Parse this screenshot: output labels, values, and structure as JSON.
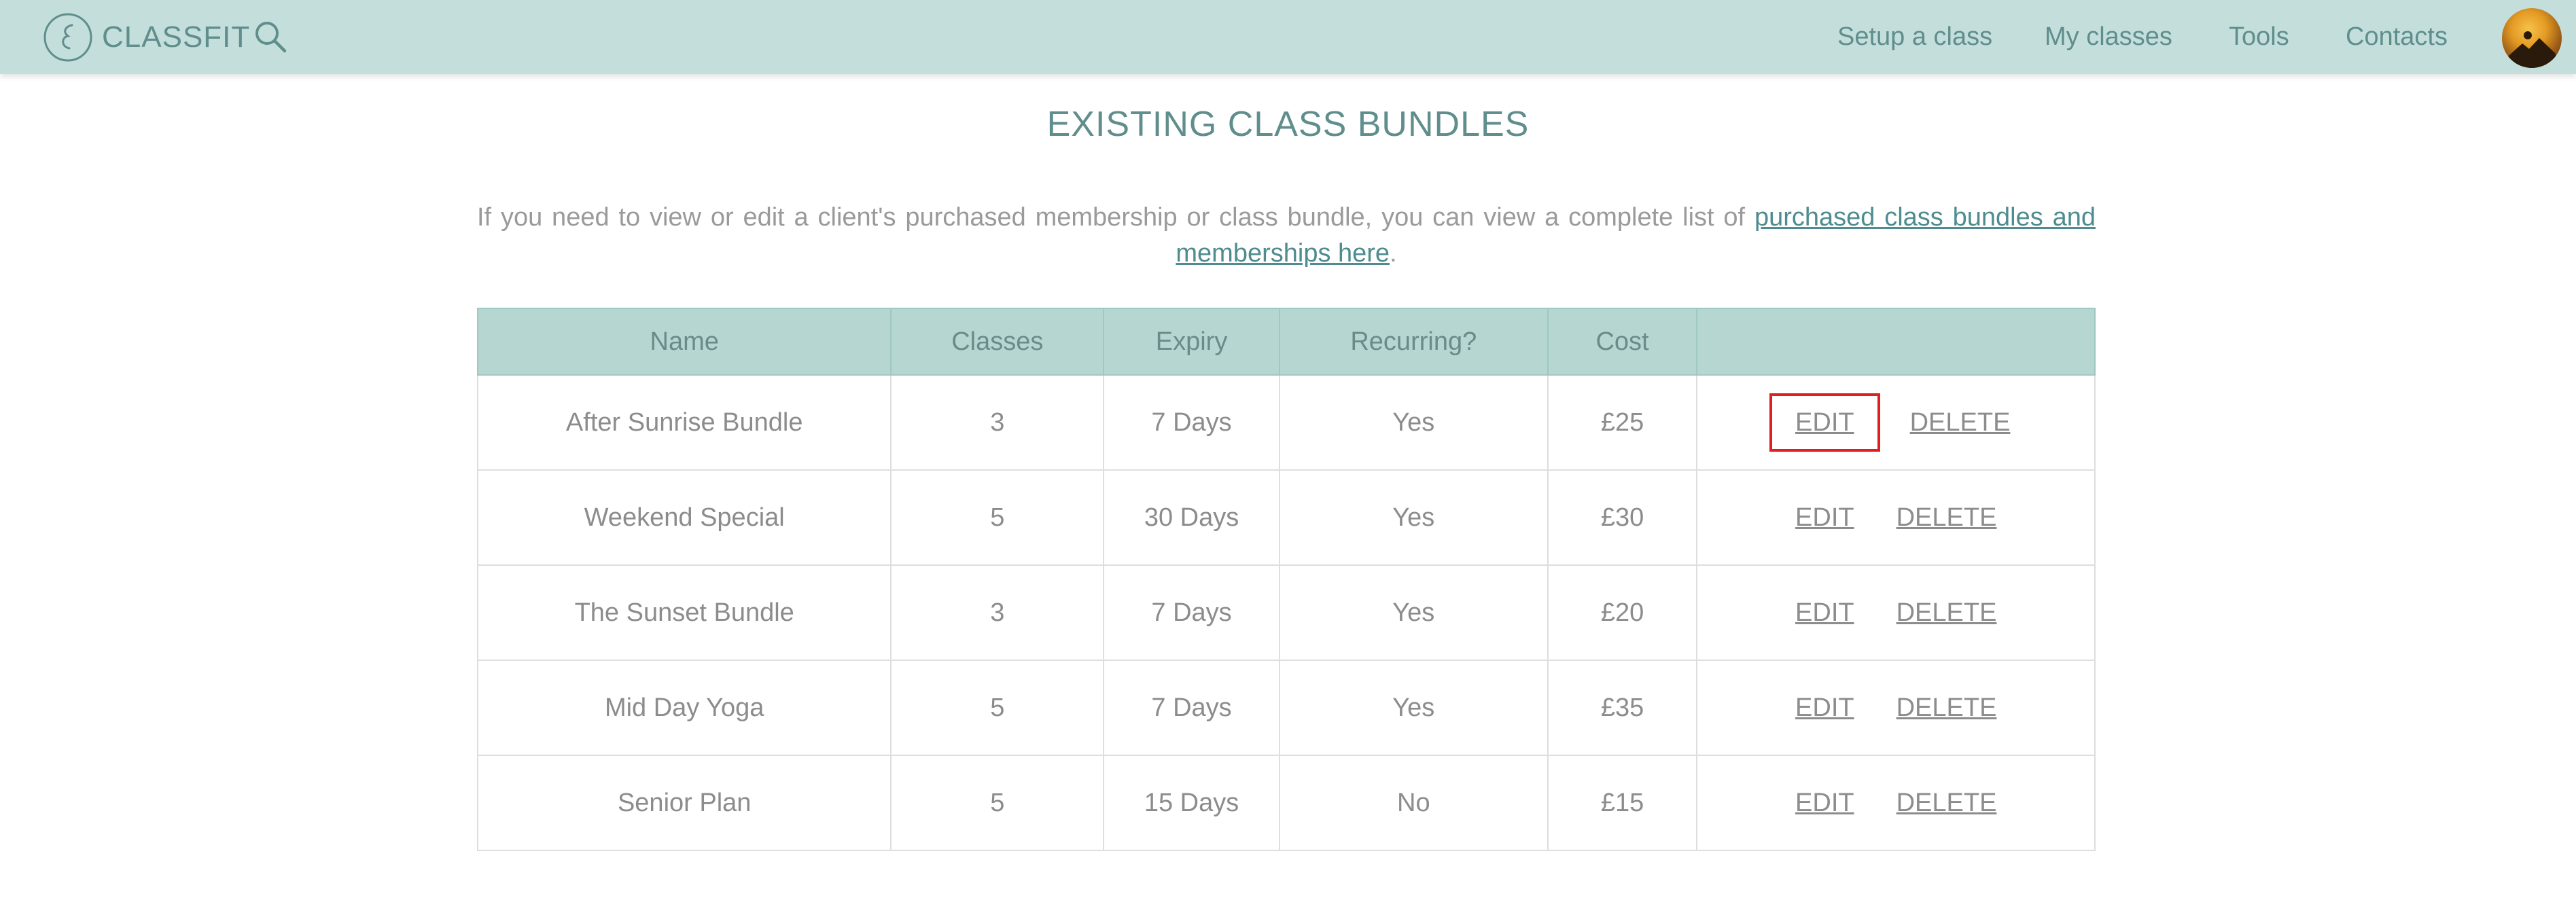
{
  "nav": {
    "brand": "CLASSFIT",
    "links": [
      "Setup a class",
      "My classes",
      "Tools",
      "Contacts"
    ]
  },
  "page": {
    "title": "EXISTING CLASS BUNDLES",
    "intro_text": "If you need to view or edit a client's purchased membership or class bundle, you can view a complete list of ",
    "intro_link": "purchased class bundles and memberships here",
    "intro_end": "."
  },
  "table": {
    "headers": [
      "Name",
      "Classes",
      "Expiry",
      "Recurring?",
      "Cost",
      ""
    ],
    "rows": [
      {
        "name": "After Sunrise Bundle",
        "classes": "3",
        "expiry": "7 Days",
        "recurring": "Yes",
        "cost": "£25",
        "edit": "EDIT",
        "delete": "DELETE"
      },
      {
        "name": "Weekend Special",
        "classes": "5",
        "expiry": "30 Days",
        "recurring": "Yes",
        "cost": "£30",
        "edit": "EDIT",
        "delete": "DELETE"
      },
      {
        "name": "The Sunset Bundle",
        "classes": "3",
        "expiry": "7 Days",
        "recurring": "Yes",
        "cost": "£20",
        "edit": "EDIT",
        "delete": "DELETE"
      },
      {
        "name": "Mid Day Yoga",
        "classes": "5",
        "expiry": "7 Days",
        "recurring": "Yes",
        "cost": "£35",
        "edit": "EDIT",
        "delete": "DELETE"
      },
      {
        "name": "Senior Plan",
        "classes": "5",
        "expiry": "15 Days",
        "recurring": "No",
        "cost": "£15",
        "edit": "EDIT",
        "delete": "DELETE"
      }
    ]
  },
  "colors": {
    "nav_bg": "#c4dfdb",
    "header_bg": "#b6d6d1",
    "accent": "#5f8e8c",
    "highlight": "#e02020"
  },
  "icons": {
    "brand": "classfit-logo-icon",
    "search": "search-icon",
    "avatar": "avatar"
  }
}
